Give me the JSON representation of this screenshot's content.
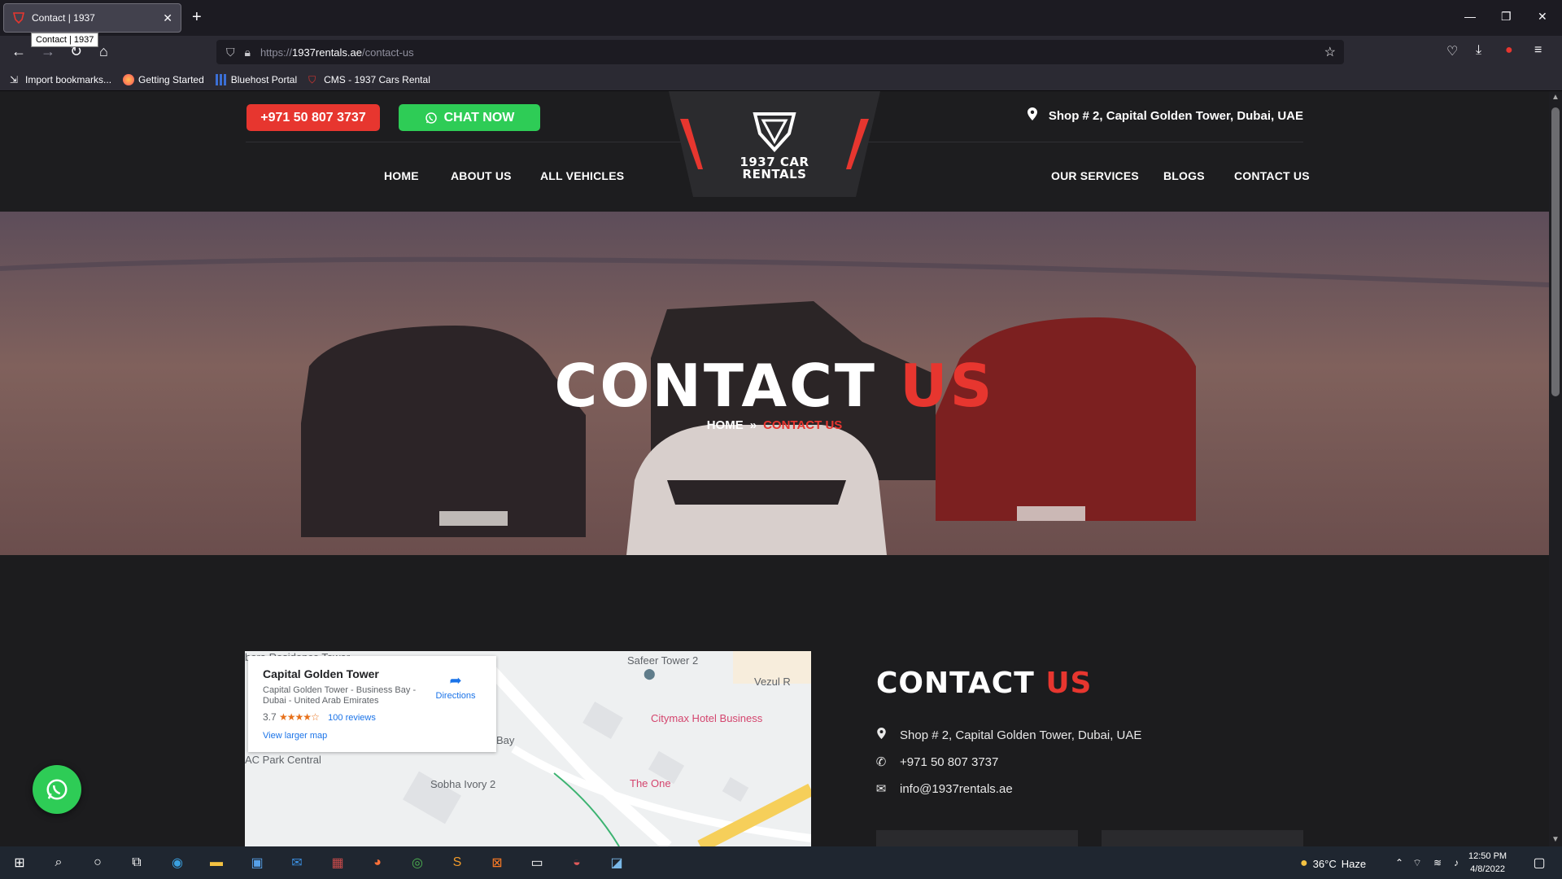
{
  "browser": {
    "tab_title": "Contact | 1937",
    "tooltip": "Contact | 1937",
    "url_prefix": "https://",
    "url_host": "1937rentals.ae",
    "url_path": "/contact-us",
    "bookmarks": [
      {
        "label": "Import bookmarks..."
      },
      {
        "label": "Getting Started"
      },
      {
        "label": "Bluehost Portal"
      },
      {
        "label": "CMS - 1937 Cars Rental"
      }
    ]
  },
  "header": {
    "phone_label": "+971 50 807 3737",
    "chat_label": "CHAT NOW",
    "address": "Shop # 2, Capital Golden Tower, Dubai, UAE",
    "logo_line1": "1937 CAR",
    "logo_line2": "RENTALS",
    "nav_left": [
      "HOME",
      "ABOUT US",
      "ALL VEHICLES"
    ],
    "nav_right": [
      "OUR SERVICES",
      "BLOGS",
      "CONTACT US"
    ]
  },
  "hero": {
    "title_part1": "CONTACT",
    "title_part2": "US",
    "breadcrumb_home": "HOME",
    "breadcrumb_sep": "»",
    "breadcrumb_current": "CONTACT US"
  },
  "map": {
    "place_name": "Capital Golden Tower",
    "place_address": "Capital Golden Tower - Business Bay - Dubai - United Arab Emirates",
    "rating": "3.7",
    "stars": "★★★★☆",
    "reviews": "100 reviews",
    "directions": "Directions",
    "larger_map": "View larger map",
    "labels": {
      "top_left": "bora Residence Tower",
      "safeer": "Safeer Tower 2",
      "vezul": "Vezul R",
      "citymax": "Citymax Hotel Business",
      "bay": "Bay",
      "park": "AC Park Central",
      "sobha": "Sobha Ivory 2",
      "the_one": "The One"
    }
  },
  "contact": {
    "heading_part1": "CONTACT",
    "heading_part2": "US",
    "address": "Shop # 2, Capital Golden Tower, Dubai, UAE",
    "phone": "+971 50 807 3737",
    "email": "info@1937rentals.ae"
  },
  "taskbar": {
    "temperature": "36°C",
    "weather": "Haze",
    "time": "12:50 PM",
    "date": "4/8/2022"
  },
  "colors": {
    "accent_red": "#e7362f",
    "whatsapp_green": "#2ecc56",
    "page_bg": "#1c1c1e"
  }
}
